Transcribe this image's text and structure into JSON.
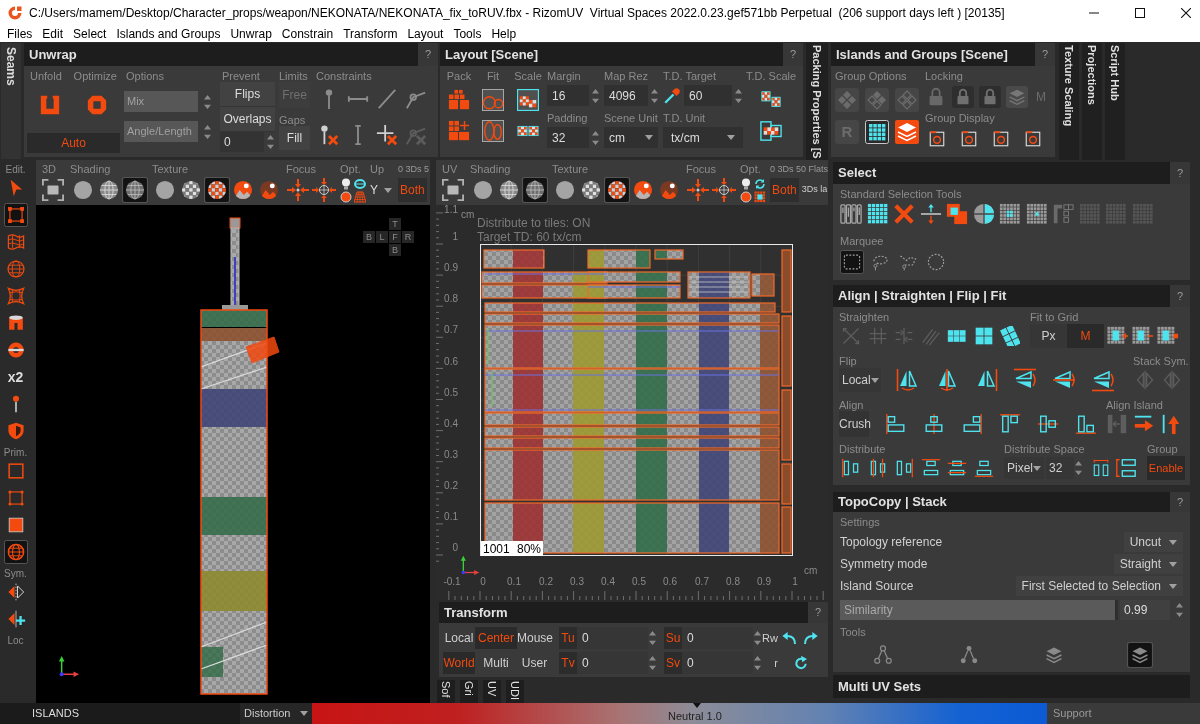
{
  "window": {
    "title": "C:/Users/mamem/Desktop/Character_props/weapon/NEKONATA/NEKONATA_fix_toRUV.fbx - RizomUV  Virtual Spaces 2022.0.23.gef571bb Perpetual  (206 support days left ) [20135]"
  },
  "menu": [
    "Files",
    "Edit",
    "Select",
    "Islands and Groups",
    "Unwrap",
    "Constrain",
    "Transform",
    "Layout",
    "Tools",
    "Help"
  ],
  "top_tabs": {
    "left": "Seams",
    "packing": "Packing Properties [S",
    "right": [
      "Texture Scaling",
      "Projections",
      "Script Hub"
    ]
  },
  "unwrap": {
    "title": "Unwrap",
    "help": "?",
    "unfold": "Unfold",
    "optimize": "Optimize",
    "auto": {
      "label": "Auto",
      "on": true
    },
    "options": "Options",
    "option_fields": [
      "Mix",
      "Angle/Length"
    ],
    "prevent": "Prevent",
    "prevent_buttons": [
      "Flips",
      "Overlaps"
    ],
    "prevent_value": "0",
    "limits": "Limits",
    "free": {
      "label": "Free",
      "disabled": true
    },
    "gaps": "Gaps",
    "fill": "Fill",
    "constraints": "Constraints"
  },
  "layout": {
    "title": "Layout [Scene]",
    "help": "?",
    "pack": "Pack",
    "fit": "Fit",
    "scale": "Scale",
    "margin": {
      "label": "Margin",
      "value": "16"
    },
    "padding": {
      "label": "Padding",
      "value": "32"
    },
    "map_rez": {
      "label": "Map Rez",
      "value": "4096"
    },
    "scene_unit": {
      "label": "Scene Unit",
      "value": "cm"
    },
    "td_target": {
      "label": "T.D. Target",
      "value": "60"
    },
    "td_unit": {
      "label": "T.D. Unit",
      "value": "tx/cm"
    },
    "td_scale": "T.D. Scale"
  },
  "islands_groups": {
    "title": "Islands and Groups [Scene]",
    "help": "?",
    "group_options": "Group Options",
    "options": [
      {
        "selected": false
      },
      {
        "selected": false
      },
      {
        "selected": false
      },
      {
        "selected": false,
        "letter": "R"
      },
      {
        "selected": true
      },
      {
        "selected": true
      }
    ],
    "locking": "Locking",
    "lock_mode": "M",
    "group_display": "Group Display"
  },
  "left_toolbar": {
    "sections": [
      {
        "label": "Edit.",
        "tools": [
          {
            "selected": false
          },
          {
            "selected": true
          },
          {
            "selected": false
          },
          {
            "selected": false
          },
          {
            "selected": false
          },
          {
            "selected": false
          },
          {
            "selected": false
          },
          {
            "selected": false,
            "text": "x2"
          },
          {
            "selected": false
          },
          {
            "selected": false
          }
        ]
      },
      {
        "label": "Prim.",
        "tools": [
          {
            "selected": false
          },
          {
            "selected": false
          },
          {
            "selected": false
          },
          {
            "selected": true
          }
        ]
      },
      {
        "label": "Sym.",
        "tools": [
          {
            "selected": false
          },
          {
            "selected": false
          }
        ]
      },
      {
        "label": "Loc"
      }
    ]
  },
  "viewport_3d": {
    "toolbar": {
      "view": "3D",
      "shading": {
        "label": "Shading",
        "modes": [
          {
            "selected": false
          },
          {
            "selected": false
          },
          {
            "selected": true
          }
        ]
      },
      "texture": {
        "label": "Texture",
        "modes": [
          {
            "selected": false
          },
          {
            "selected": false
          },
          {
            "selected": true
          },
          {
            "selected": false
          },
          {
            "selected": false
          }
        ]
      },
      "focus": "Focus",
      "options": "Opt.",
      "up": {
        "label": "Up",
        "value": "Y"
      },
      "stats": "0 3Ds 5",
      "display": "Both"
    },
    "view_cube": [
      "T",
      "B",
      "L",
      "F",
      "R",
      "B"
    ]
  },
  "viewport_uv": {
    "toolbar": {
      "view": "UV",
      "shading": {
        "label": "Shading",
        "modes": [
          {
            "selected": false
          },
          {
            "selected": false
          },
          {
            "selected": true
          }
        ]
      },
      "texture": {
        "label": "Texture",
        "modes": [
          {
            "selected": false
          },
          {
            "selected": false
          },
          {
            "selected": true
          },
          {
            "selected": false
          },
          {
            "selected": false
          }
        ]
      },
      "focus": "Focus",
      "options": "Opt.",
      "stats": "0 3Ds 50 Flats",
      "display": "Both",
      "extra": "3Ds la"
    },
    "overlay": [
      "Distribute to tiles: ON",
      "Target TD: 60 tx/cm"
    ],
    "tile": {
      "number": "1001",
      "zoom": "80%"
    },
    "v_ruler": {
      "unit": "cm",
      "labels": [
        "1.1",
        "1",
        "0.9",
        "0.8",
        "0.7",
        "0.6",
        "0.5",
        "0.4",
        "0.3",
        "0.2",
        "0.1",
        "0"
      ]
    },
    "u_ruler": {
      "unit": "cm",
      "labels": [
        "-0.1",
        "0",
        "0.1",
        "0.2",
        "0.3",
        "0.4",
        "0.5",
        "0.6",
        "0.7",
        "0.8",
        "0.9",
        "1"
      ]
    }
  },
  "transform": {
    "title": "Transform",
    "help": "?",
    "modes": [
      {
        "label": "Local",
        "selected": false
      },
      {
        "label": "Center",
        "selected": true
      },
      {
        "label": "Mouse",
        "selected": false
      },
      {
        "label": "World",
        "selected": true
      },
      {
        "label": "Multi",
        "selected": false
      },
      {
        "label": "User",
        "selected": false
      }
    ],
    "fields": [
      {
        "label": "Tu",
        "value": "0"
      },
      {
        "label": "Su",
        "value": "0"
      },
      {
        "label": "Tv",
        "value": "0"
      },
      {
        "label": "Sv",
        "value": "0"
      }
    ],
    "cut_labels": [
      "Rw",
      "r"
    ]
  },
  "bottom_tabs": [
    "Sof",
    "Gri",
    "UV",
    "UDI"
  ],
  "select_panel": {
    "title": "Select",
    "help": "?",
    "standard_tools": "Standard Selection Tools",
    "marquee": {
      "label": "Marquee",
      "tools": [
        {
          "selected": true
        },
        {
          "selected": false
        },
        {
          "selected": false
        },
        {
          "selected": false
        }
      ]
    }
  },
  "align_panel": {
    "title": "Align | Straighten | Flip | Fit",
    "help": "?",
    "straighten": "Straighten",
    "fit_to_grid": {
      "label": "Fit to Grid",
      "units": [
        {
          "label": "Px",
          "selected": false
        },
        {
          "label": "M",
          "selected": true
        }
      ]
    },
    "flip": {
      "label": "Flip",
      "space": "Local"
    },
    "stack_sym": "Stack Sym.",
    "align": {
      "label": "Align",
      "crush": "Crush"
    },
    "align_island": "Align Island",
    "distribute": "Distribute",
    "distribute_space": {
      "label": "Distribute Space",
      "unit": "Pixel",
      "value": "32"
    },
    "group": {
      "label": "Group",
      "button": "Enable",
      "on": true
    }
  },
  "topocopy": {
    "title": "TopoCopy | Stack",
    "help": "?",
    "settings": "Settings",
    "rows": [
      {
        "label": "Topology reference",
        "value": "Uncut"
      },
      {
        "label": "Symmetry mode",
        "value": "Straight"
      },
      {
        "label": "Island Source",
        "value": "First Selected to Selection"
      }
    ],
    "similarity": {
      "label": "Similarity",
      "level": 0.99,
      "value": "0.99"
    },
    "tools": {
      "label": "Tools",
      "items": [
        {
          "selected": false
        },
        {
          "selected": false
        },
        {
          "selected": false
        },
        {
          "selected": true
        }
      ]
    }
  },
  "multi_uv_sets": {
    "title": "Multi UV Sets"
  },
  "status_bar": {
    "mode": "ISLANDS",
    "display": "Distortion",
    "neutral": "Neutral 1.0",
    "support": "Support"
  }
}
